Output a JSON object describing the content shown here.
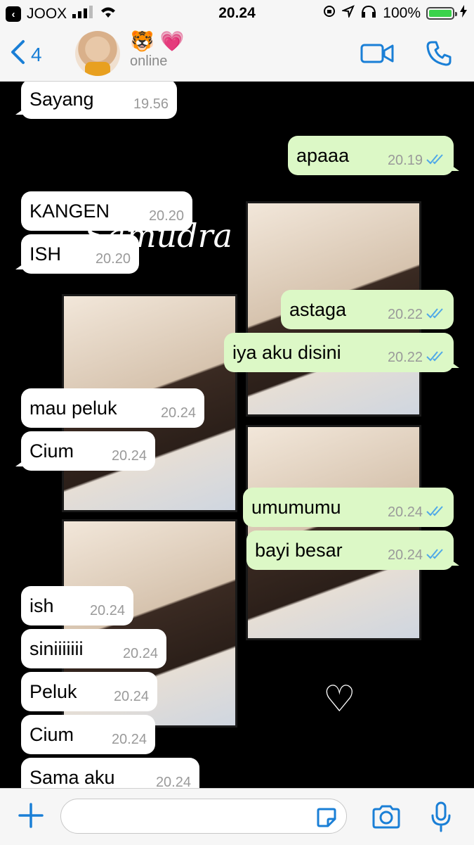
{
  "status_bar": {
    "carrier": "JOOX",
    "time": "20.24",
    "battery": "100%"
  },
  "header": {
    "back_count": "4",
    "contact_emoji": "🐯 💗",
    "contact_status": "online"
  },
  "wallpaper": {
    "brand_text": "Samudra"
  },
  "messages": [
    {
      "text": "Sayang",
      "time": "19.56",
      "dir": "in"
    },
    {
      "text": "apaaa",
      "time": "20.19",
      "dir": "out"
    },
    {
      "text": "KANGEN",
      "time": "20.20",
      "dir": "in"
    },
    {
      "text": "ISH",
      "time": "20.20",
      "dir": "in"
    },
    {
      "text": "astaga",
      "time": "20.22",
      "dir": "out"
    },
    {
      "text": "iya aku disini",
      "time": "20.22",
      "dir": "out"
    },
    {
      "text": "mau peluk",
      "time": "20.24",
      "dir": "in"
    },
    {
      "text": "Cium",
      "time": "20.24",
      "dir": "in"
    },
    {
      "text": "umumumu",
      "time": "20.24",
      "dir": "out"
    },
    {
      "text": "bayi besar",
      "time": "20.24",
      "dir": "out"
    },
    {
      "text": "ish",
      "time": "20.24",
      "dir": "in"
    },
    {
      "text": "siniiiiiii",
      "time": "20.24",
      "dir": "in"
    },
    {
      "text": "Peluk",
      "time": "20.24",
      "dir": "in"
    },
    {
      "text": "Cium",
      "time": "20.24",
      "dir": "in"
    },
    {
      "text": "Sama aku",
      "time": "20.24",
      "dir": "in"
    }
  ],
  "icons": {
    "back": "chevron-left-icon",
    "video": "video-call-icon",
    "phone": "phone-icon",
    "add": "plus-icon",
    "sticker": "sticker-icon",
    "camera": "camera-icon",
    "mic": "microphone-icon",
    "read": "double-check-icon"
  },
  "colors": {
    "accent": "#1a7fd6",
    "outgoing_bubble": "#dcf8c6",
    "incoming_bubble": "#ffffff",
    "read_receipt": "#4fa8e8"
  }
}
